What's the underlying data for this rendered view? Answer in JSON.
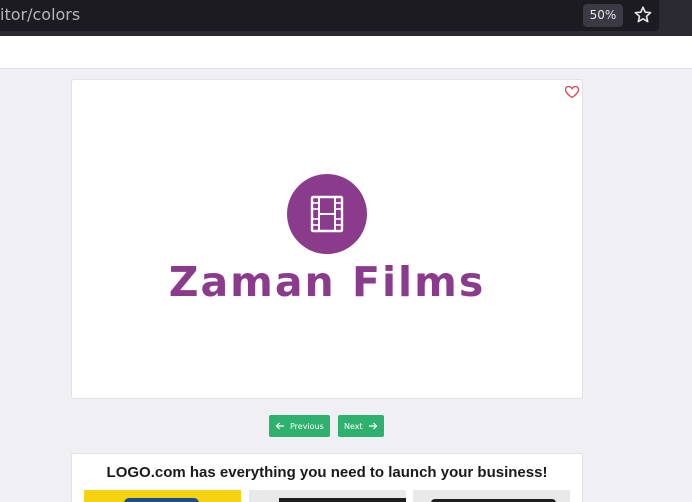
{
  "browser": {
    "url": "itor/colors",
    "zoom": "50%"
  },
  "logo": {
    "brand_name": "Zaman Films",
    "brand_color": "#8a3b8b",
    "icon": "film-strip-icon"
  },
  "pager": {
    "previous_label": "Previous",
    "next_label": "Next"
  },
  "promo": {
    "title": "LOGO.com has everything you need to launch your business!"
  },
  "colors": {
    "button_green": "#2fb16e",
    "favorite_red": "#e0434b"
  }
}
